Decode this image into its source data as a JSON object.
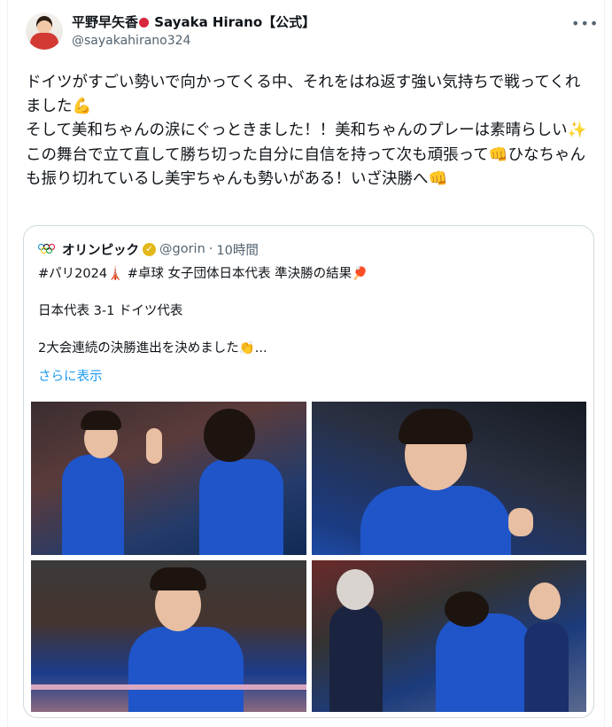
{
  "post": {
    "display_name": "平野早矢香",
    "display_name_suffix": "Sayaka Hirano【公式】",
    "handle": "@sayakahirano324",
    "more_label": "•••",
    "text": "ドイツがすごい勢いで向かってくる中、それをはね返す強い気持ちで戦ってくれました💪\nそして美和ちゃんの涙にぐっときました！！美和ちゃんのプレーは素晴らしい✨この舞台で立て直して勝ち切った自分に自信を持って次も頑張って👊ひなちゃんも振り切れているし美宇ちゃんも勢いがある！いざ決勝へ👊"
  },
  "quoted": {
    "display_name": "オリンピック",
    "verified_mark": "✓",
    "handle": "@gorin",
    "separator": "·",
    "time": "10時間",
    "text": "#パリ2024🗼 #卓球 女子団体日本代表 準決勝の結果🏓\n\n日本代表 3-1 ドイツ代表\n\n2大会連続の決勝進出を決めました👏...",
    "show_more": "さらに表示"
  },
  "colors": {
    "link": "#1d9bf0",
    "secondary_text": "#536471",
    "border": "#cfd9de",
    "jersey": "#1f55c8"
  },
  "icons": [
    "more-options-icon",
    "verified-badge-icon",
    "olympic-rings-icon",
    "ping-pong-paddle-icon"
  ]
}
